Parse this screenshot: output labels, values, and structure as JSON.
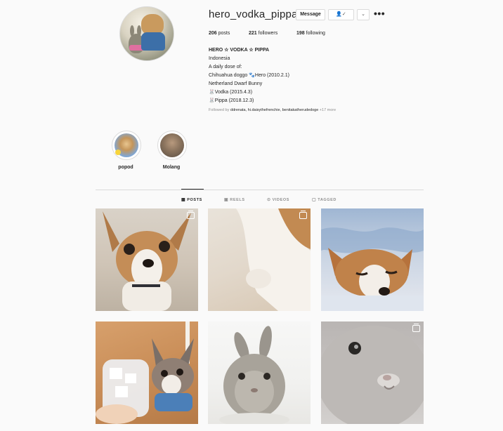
{
  "profile": {
    "username": "hero_vodka_pippa",
    "message_label": "Message",
    "follow_icon_label": "👤✓",
    "chevron_label": "⌄",
    "more_label": "•••"
  },
  "stats": {
    "posts_count": "206",
    "posts_label": "posts",
    "followers_count": "221",
    "followers_label": "followers",
    "following_count": "198",
    "following_label": "following"
  },
  "bio": {
    "name": "HERO ☆ VODKA ☆ PIPPA",
    "lines": [
      "Indonesia",
      "A daily dose of:",
      "Chihuahua doggo 🐾Hero (2010.2.1)",
      "Netherland Dwarf Bunny",
      "🐰Vodka (2015.4.3)",
      "🐰Pippa (2018.12.3)"
    ],
    "followed_prefix": "Followed by",
    "followed_users": "ddrenata, hi.daisythefrenchie, benitakatherudedoge",
    "followed_more": "+17 more"
  },
  "highlights": [
    {
      "label": "popod"
    },
    {
      "label": "Molang"
    }
  ],
  "tabs": [
    {
      "label": "POSTS",
      "icon": "grid-icon",
      "glyph": "▦",
      "active": true
    },
    {
      "label": "REELS",
      "icon": "reels-icon",
      "glyph": "▣",
      "active": false
    },
    {
      "label": "VIDEOS",
      "icon": "video-icon",
      "glyph": "⊙",
      "active": false
    },
    {
      "label": "TAGGED",
      "icon": "tag-icon",
      "glyph": "▢",
      "active": false
    }
  ],
  "posts": [
    {
      "subject": "chihuahua",
      "multi": true
    },
    {
      "subject": "chihuahua-paws",
      "multi": true
    },
    {
      "subject": "chihuahua-sleeping",
      "multi": false
    },
    {
      "subject": "chihuahua-with-drink",
      "multi": false
    },
    {
      "subject": "grey-bunny",
      "multi": false
    },
    {
      "subject": "grey-bunny-closeup",
      "multi": true
    }
  ],
  "colors": {
    "background": "#fafafa",
    "text": "#262626",
    "secondary": "#8e8e8e",
    "border": "#dbdbdb"
  }
}
